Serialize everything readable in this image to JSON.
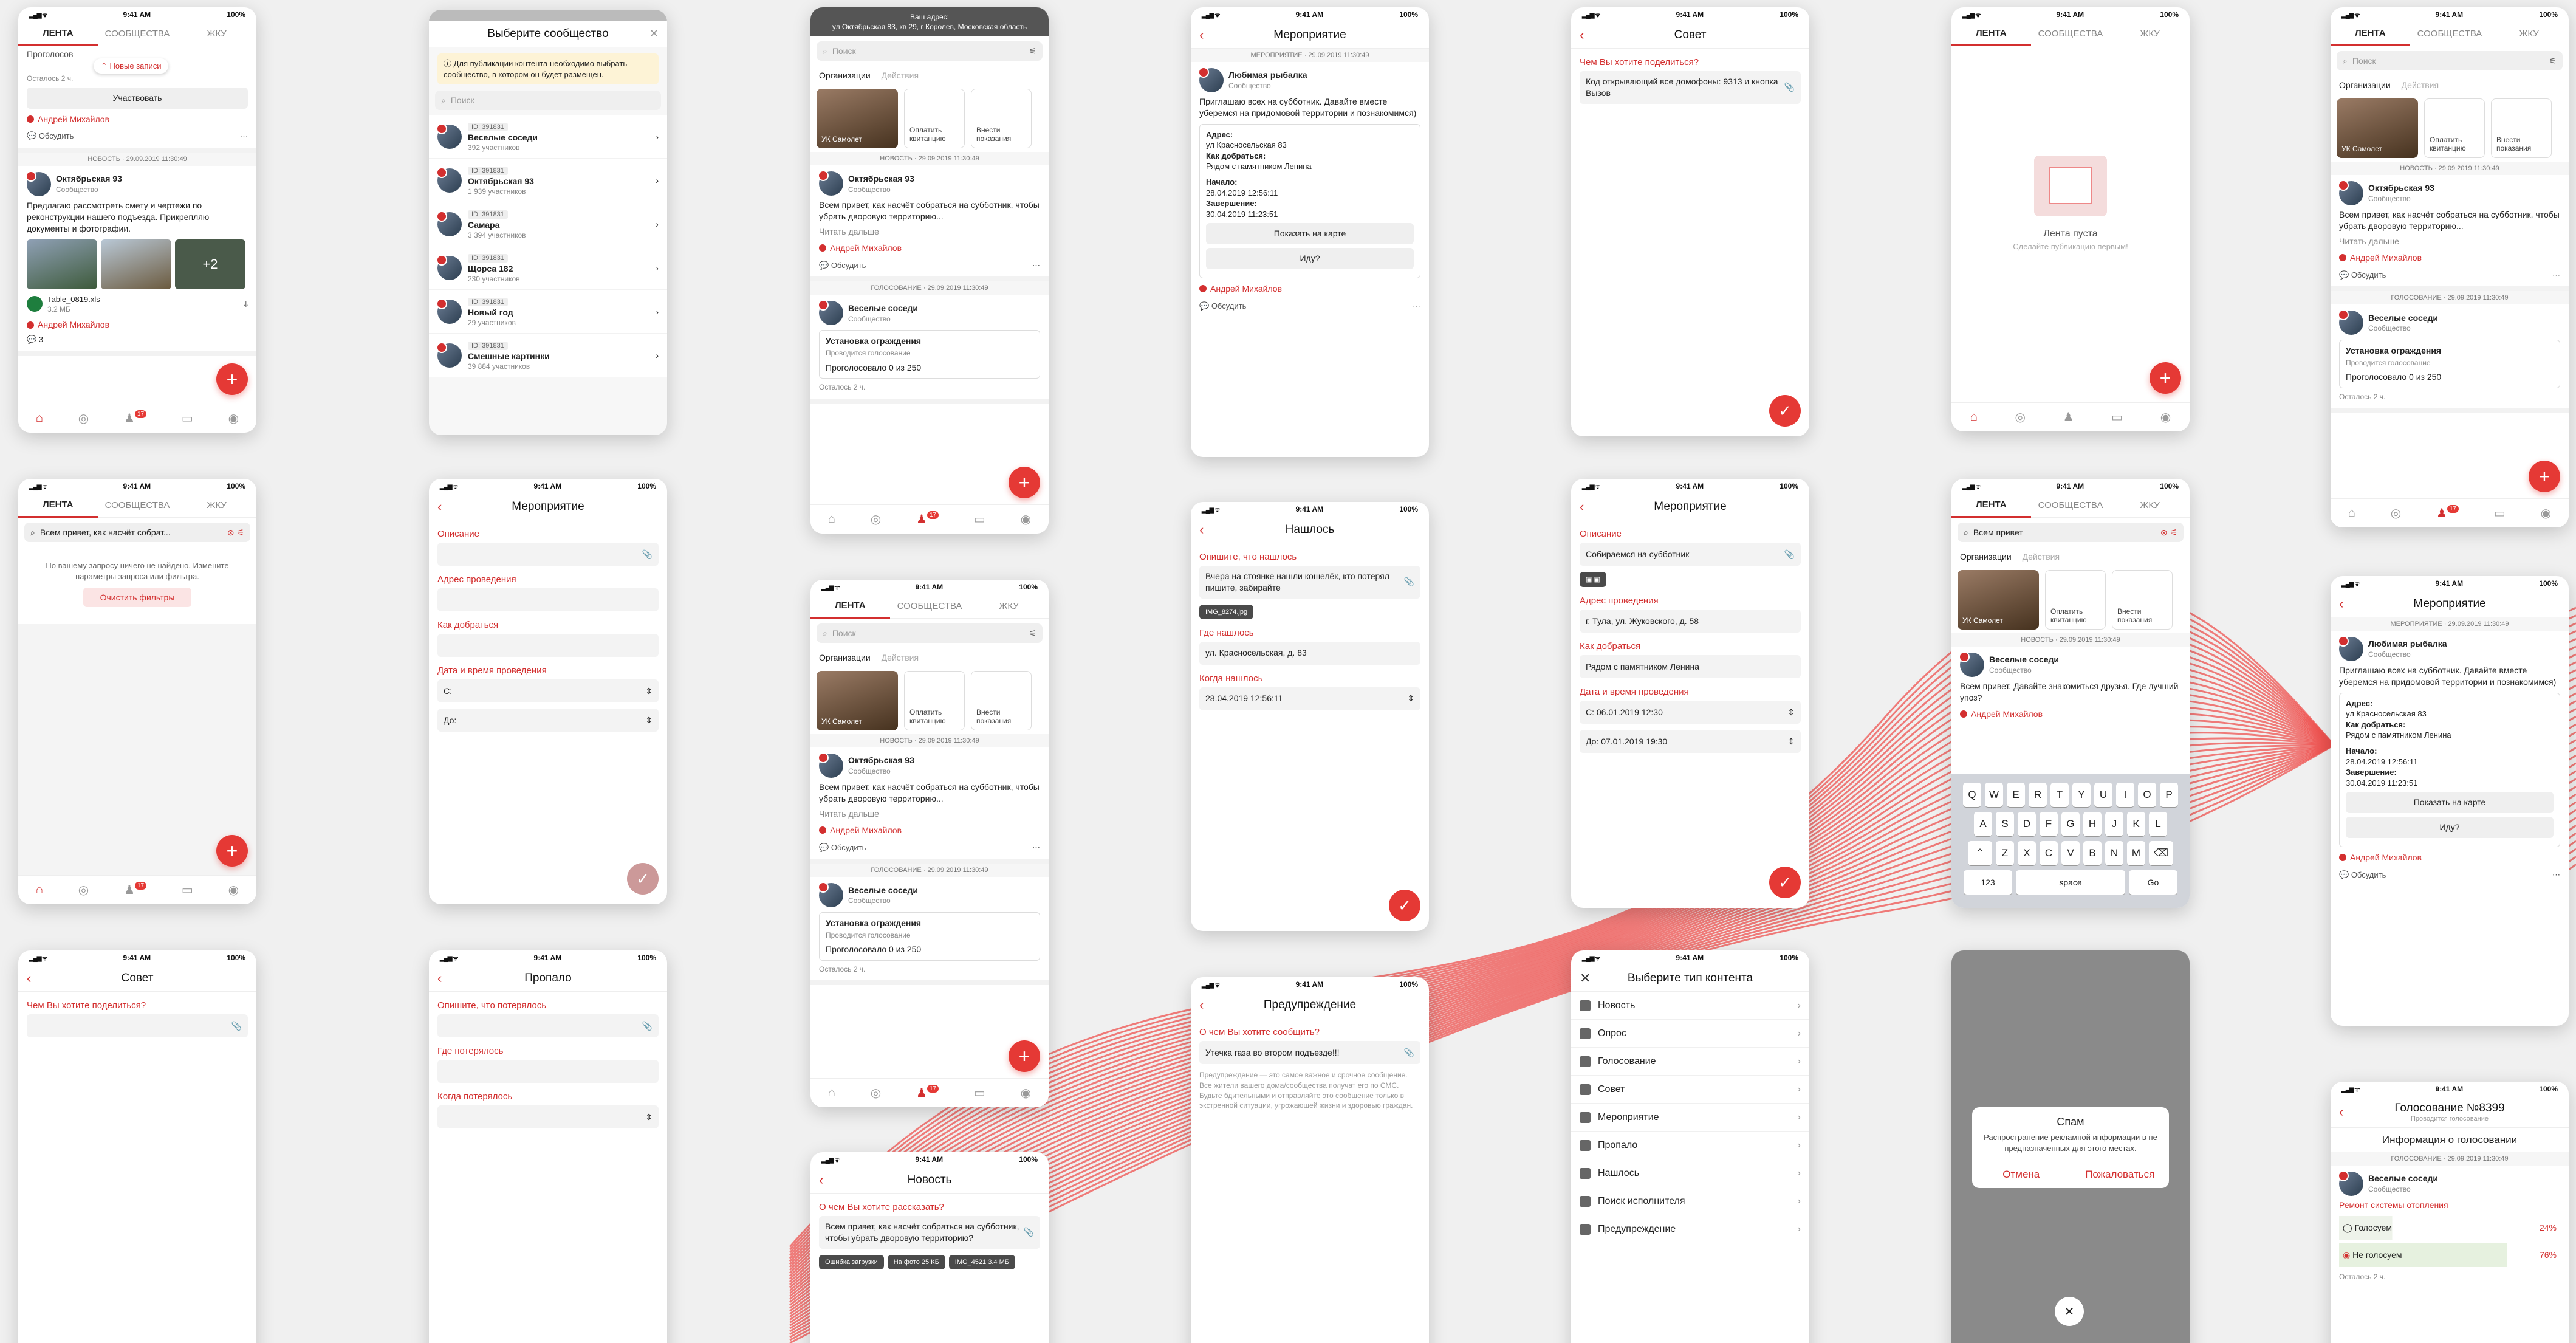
{
  "status": {
    "time": "9:41 AM",
    "battery": "100%"
  },
  "tabs": {
    "feed": "ЛЕНТА",
    "communities": "СООБЩЕСТВА",
    "hoa": "ЖКУ"
  },
  "common": {
    "search": "Поиск",
    "discuss": "Обсудить",
    "user": "Андрей Михайлов",
    "read_more": "Читать дальше",
    "community": "Сообщество",
    "orgs": "Организации",
    "actions": "Действия",
    "org_name": "УК Самолет",
    "pay": "Оплатить квитанцию",
    "meter": "Внести показания",
    "show_map": "Показать на карте",
    "going": "Иду?"
  },
  "p1": {
    "voted_partial": "Проголосов",
    "new_posts": "Новые записи",
    "left": "Осталось 2 ч.",
    "participate": "Участвовать",
    "meta": "НОВОСТЬ · 29.09.2019 11:30:49",
    "name": "Октябрьская 93",
    "text": "Предлагаю рассмотреть смету и чертежи по реконструкции нашего подъезда. Прикрепляю документы и фотографии.",
    "more": "+2",
    "file": "Table_0819.xls",
    "size": "3.2 МБ",
    "count": "3"
  },
  "p2": {
    "title": "Выберите сообщество",
    "warn": "Для публикации контента необходимо выбрать сообщество, в котором он будет размещен.",
    "list": [
      {
        "id": "ID: 391831",
        "name": "Веселые соседи",
        "p": "392 участников"
      },
      {
        "id": "ID: 391831",
        "name": "Октябрьская 93",
        "p": "1 939 участников"
      },
      {
        "id": "ID: 391831",
        "name": "Самара",
        "p": "3 394 участников"
      },
      {
        "id": "ID: 391831",
        "name": "Щорса 182",
        "p": "230 участников"
      },
      {
        "id": "ID: 391831",
        "name": "Новый год",
        "p": "29 участников"
      },
      {
        "id": "ID: 391831",
        "name": "Смешные картинки",
        "p": "39 884 участников"
      }
    ]
  },
  "p3": {
    "addr_label": "Ваш адрес:",
    "addr": "ул Октябрьская 83, кв 29, г Королев, Московская область",
    "meta": "НОВОСТЬ · 29.09.2019 11:30:49",
    "name": "Октябрьская 93",
    "text": "Всем привет, как насчёт собраться на субботник, чтобы убрать дворовую территорию...",
    "vmeta": "ГОЛОСОВАНИЕ · 29.09.2019 11:30:49",
    "vname": "Веселые соседи",
    "vt": "Установка ограждения",
    "vs": "Проводится голосование",
    "vc": "Проголосовало 0 из 250",
    "left": "Осталось 2 ч."
  },
  "p4": {
    "title": "Мероприятие",
    "meta": "МЕРОПРИЯТИЕ · 29.09.2019 11:30:49",
    "name": "Любимая рыбалка",
    "text": "Приглашаю всех на субботник. Давайте вместе уберемся на придомовой территории и познакомимся)",
    "addr_l": "Адрес:",
    "addr": "ул Красносельская 83",
    "how_l": "Как добраться:",
    "how": "Рядом с памятником Ленина",
    "start_l": "Начало:",
    "start": "28.04.2019 12:56:11",
    "end_l": "Завершение:",
    "end": "30.04.2019 11:23:51"
  },
  "p5": {
    "title": "Совет",
    "lbl": "Чем Вы хотите поделиться?",
    "val": "Код открывающий все домофоны: 9313 и кнопка Вызов"
  },
  "p6": {
    "empty": "Лента пуста",
    "hint": "Сделайте публикацию первым!"
  },
  "p7": {
    "meta": "НОВОСТЬ · 29.09.2019 11:30:49",
    "name": "Октябрьская 93",
    "text": "Всем привет, как насчёт собраться на субботник, чтобы убрать дворовую территорию..."
  },
  "p8": {
    "query": "Всем привет, как насчёт собрат...",
    "nf": "По вашему запросу ничего не найдено. Измените параметры запроса или фильтра.",
    "clear": "Очистить фильтры"
  },
  "p9": {
    "title": "Мероприятие",
    "desc": "Описание",
    "addr": "Адрес проведения",
    "how": "Как добраться",
    "dt": "Дата и время проведения",
    "from": "С:",
    "to": "До:"
  },
  "p10": {
    "title": "Нашлось",
    "l1": "Опишите, что нашлось",
    "v1": "Вчера на стоянке нашли кошелёк, кто потерял пишите, забирайте",
    "img": "IMG_8274.jpg",
    "l2": "Где нашлось",
    "v2": "ул. Красносельская, д. 83",
    "l3": "Когда нашлось",
    "v3": "28.04.2019 12:56:11"
  },
  "p11": {
    "title": "Мероприятие",
    "desc": "Описание",
    "dv": "Собираемся на субботник",
    "addr": "Адрес проведения",
    "av": "г. Тула, ул. Жуковского, д. 58",
    "how": "Как добраться",
    "hv": "Рядом с памятником Ленина",
    "dt": "Дата и время проведения",
    "from": "С: 06.01.2019 12:30",
    "to": "До: 07.01.2019 19:30"
  },
  "p12": {
    "query": "Всем привет",
    "meta": "НОВОСТЬ · 29.09.2019 11:30:49",
    "name": "Веселые соседи",
    "text": "Всем привет. Давайте знакомиться друзья. Где лучший упоз?",
    "keys1": [
      "Q",
      "W",
      "E",
      "R",
      "T",
      "Y",
      "U",
      "I",
      "O",
      "P"
    ],
    "keys2": [
      "A",
      "S",
      "D",
      "F",
      "G",
      "H",
      "J",
      "K",
      "L"
    ],
    "keys3": [
      "Z",
      "X",
      "C",
      "V",
      "B",
      "N",
      "M"
    ],
    "k123": "123",
    "space": "space",
    "go": "Go"
  },
  "p13": {
    "title": "Совет",
    "lbl": "Чем Вы хотите поделиться?"
  },
  "p14": {
    "title": "Пропало",
    "l1": "Опишите, что потерялось",
    "l2": "Где потерялось",
    "l3": "Когда потерялось"
  },
  "p15": {
    "title": "Новость",
    "lbl": "О чем Вы хотите рассказать?",
    "val": "Всем привет, как насчёт собраться на субботник, чтобы убрать дворовую территорию?",
    "a1": "Ошибка загрузки",
    "a2": "На фото 25 КБ",
    "a3": "IMG_4521 3.4 МБ"
  },
  "p16": {
    "title": "Предупреждение",
    "lbl": "О чем Вы хотите сообщить?",
    "val": "Утечка газа во втором подъезде!!!",
    "note": "Предупреждение — это самое важное и срочное сообщение. Все жители вашего дома/сообщества получат его по СМС. Будьте бдительными и отправляйте это сообщение только в экстренной ситуации, угрожающей жизни и здоровью граждан."
  },
  "p17": {
    "title": "Выберите тип контента",
    "items": [
      "Новость",
      "Опрос",
      "Голосование",
      "Совет",
      "Мероприятие",
      "Пропало",
      "Нашлось",
      "Поиск исполнителя",
      "Предупреждение"
    ]
  },
  "p18": {
    "title": "Спам",
    "text": "Распространение рекламной информации в не предназначенных для этого местах.",
    "cancel": "Отмена",
    "report": "Пожаловаться"
  },
  "p19": {
    "title": "Голосование №8399",
    "sub": "Проводится голосование",
    "info": "Информация о голосовании",
    "meta": "ГОЛОСОВАНИЕ · 29.09.2019 11:30:49",
    "name": "Веселые соседи",
    "q": "Ремонт системы отопления",
    "yes": "Голосуем",
    "yes_p": "24%",
    "no": "Не голосуем",
    "no_p": "76%",
    "left": "Осталось 2 ч."
  },
  "badge": "17",
  "colors": {
    "accent": "#e53935"
  }
}
